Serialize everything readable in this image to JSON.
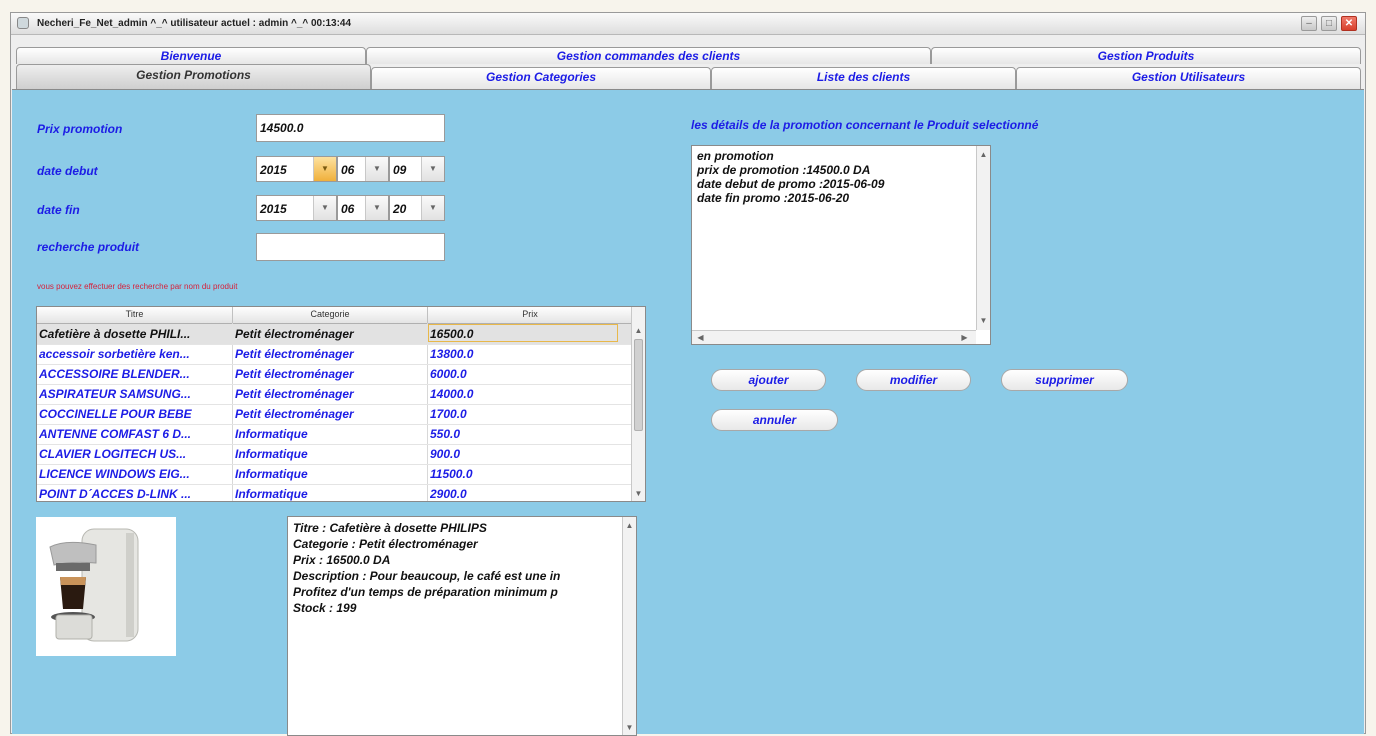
{
  "window": {
    "title": "Necheri_Fe_Net_admin  ^_^  utilisateur actuel : admin  ^_^  00:13:44"
  },
  "tabs_row1": [
    "Bienvenue",
    "Gestion commandes des clients",
    "Gestion Produits"
  ],
  "tabs_row2": [
    "Gestion Promotions",
    "Gestion Categories",
    "Liste des clients",
    "Gestion Utilisateurs"
  ],
  "form": {
    "prix_label": "Prix promotion",
    "prix_value": "14500.0",
    "date_debut_label": "date debut",
    "date_debut": {
      "year": "2015",
      "month": "06",
      "day": "09"
    },
    "date_fin_label": "date fin",
    "date_fin": {
      "year": "2015",
      "month": "06",
      "day": "20"
    },
    "recherche_label": "recherche produit",
    "recherche_value": "",
    "hint": "vous pouvez effectuer des recherche par nom du produit"
  },
  "table": {
    "columns": [
      "Titre",
      "Categorie",
      "Prix"
    ],
    "rows": [
      [
        "Cafetière à dosette PHILI...",
        "Petit électroménager",
        "16500.0"
      ],
      [
        "accessoir sorbetière ken...",
        "Petit électroménager",
        "13800.0"
      ],
      [
        "ACCESSOIRE BLENDER...",
        "Petit électroménager",
        "6000.0"
      ],
      [
        "ASPIRATEUR SAMSUNG...",
        "Petit électroménager",
        "14000.0"
      ],
      [
        "COCCINELLE POUR BEBE",
        "Petit électroménager",
        "1700.0"
      ],
      [
        "ANTENNE COMFAST 6 D...",
        "Informatique",
        "550.0"
      ],
      [
        "CLAVIER LOGITECH US...",
        "Informatique",
        "900.0"
      ],
      [
        "LICENCE WINDOWS EIG...",
        "Informatique",
        "11500.0"
      ],
      [
        "POINT D´ACCES D-LINK ...",
        "Informatique",
        "2900.0"
      ]
    ]
  },
  "product_details": [
    "Titre :  Cafetière à dosette PHILIPS",
    "Categorie  :  Petit électroménager",
    "Prix :  16500.0 DA",
    "Description :  Pour beaucoup, le café est une in",
    "Profitez d'un temps de préparation minimum p",
    "Stock :  199"
  ],
  "promo": {
    "header": "les détails de la promotion concernant le Produit selectionné",
    "lines": [
      "en promotion",
      "prix de promotion :14500.0 DA",
      "date debut de promo :2015-06-09",
      "date fin promo :2015-06-20"
    ]
  },
  "buttons": {
    "ajouter": "ajouter",
    "modifier": "modifier",
    "supprimer": "supprimer",
    "annuler": "annuler"
  },
  "colors": {
    "panel_bg": "#8ccbe7",
    "label_blue": "#1c1ce6",
    "hint_red": "#d6203a"
  }
}
